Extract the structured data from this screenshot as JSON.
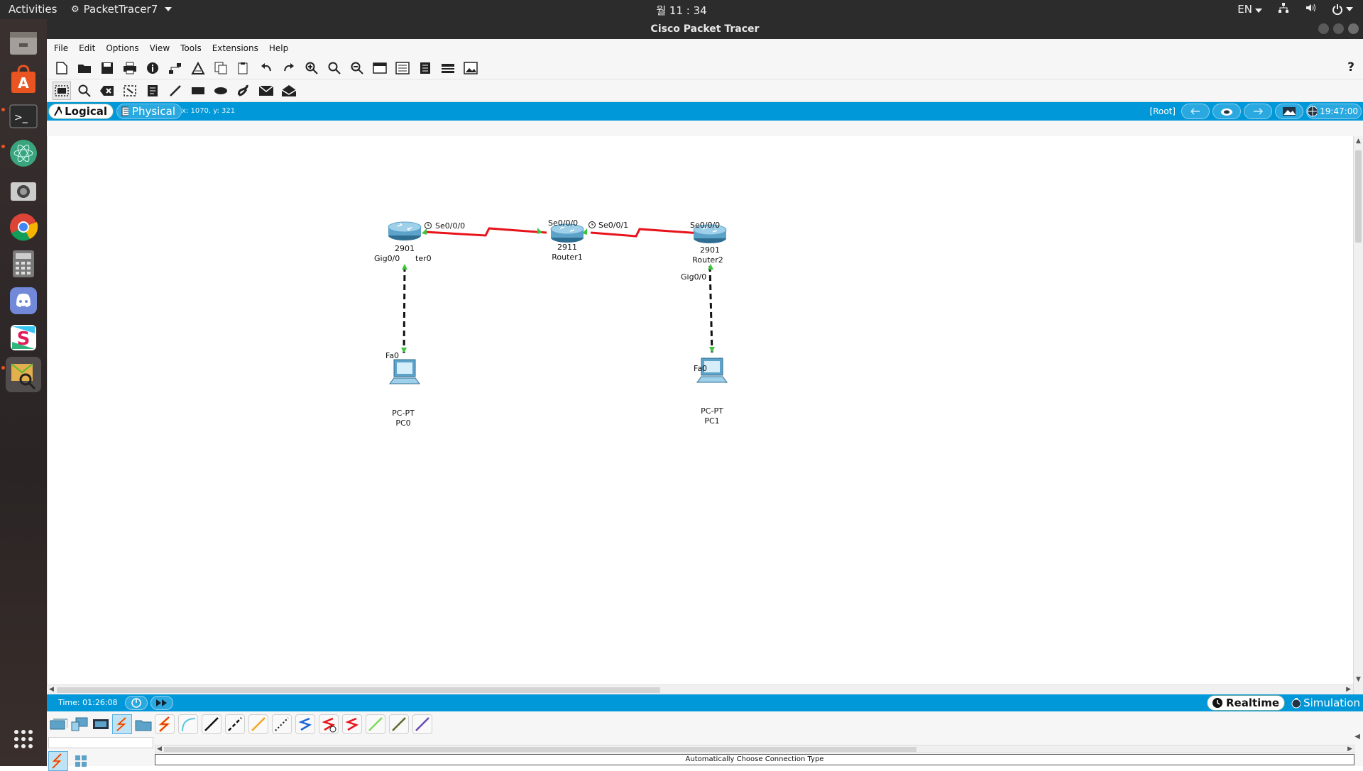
{
  "topbar": {
    "activities": "Activities",
    "app_name": "PacketTracer7",
    "clock": "월 11 : 34",
    "language": "EN"
  },
  "dock": {
    "items": [
      "files-icon",
      "software-center-icon",
      "terminal-icon",
      "atom-icon",
      "camera-icon",
      "chrome-icon",
      "calculator-icon",
      "discord-icon",
      "slack-icon",
      "packet-tracer-icon",
      "app-grid-icon"
    ]
  },
  "window": {
    "title": "Cisco Packet Tracer",
    "menu": [
      "File",
      "Edit",
      "Options",
      "View",
      "Tools",
      "Extensions",
      "Help"
    ],
    "help_glyph": "?"
  },
  "viewstrip": {
    "logical_label": "Logical",
    "physical_label": "Physical",
    "coords": "x: 1070, y: 321",
    "root_label": "[Root]",
    "time": "19:47:00"
  },
  "topology": {
    "devices": [
      {
        "id": "r0",
        "model": "2901",
        "name": "Router0",
        "model_shown": "2901",
        "name_shown": "ter0"
      },
      {
        "id": "r1",
        "model": "2911",
        "name": "Router1",
        "model_shown": "2911",
        "name_shown": "Router1"
      },
      {
        "id": "r2",
        "model": "2901",
        "name": "Router2",
        "model_shown": "2901",
        "name_shown": "Router2"
      },
      {
        "id": "pc0",
        "model": "PC-PT",
        "name": "PC0"
      },
      {
        "id": "pc1",
        "model": "PC-PT",
        "name": "PC1"
      }
    ],
    "port_labels": {
      "r0_serial": "Se0/0/0",
      "r1_serial_left": "Se0/0/0",
      "r1_serial_right": "Se0/0/1",
      "r2_serial": "Se0/0/0",
      "r0_gig": "Gig0/0",
      "r2_gig": "Gig0/0",
      "pc0_fa": "Fa0",
      "pc1_fa": "Fa0"
    },
    "colors": {
      "serial_link": "#e8121b",
      "copper_link": "#111111",
      "link_up": "#3cc43c"
    }
  },
  "bottom": {
    "time_label": "Time: 01:26:08",
    "realtime_label": "Realtime",
    "simulation_label": "Simulation",
    "status": "Automatically Choose Connection Type"
  }
}
